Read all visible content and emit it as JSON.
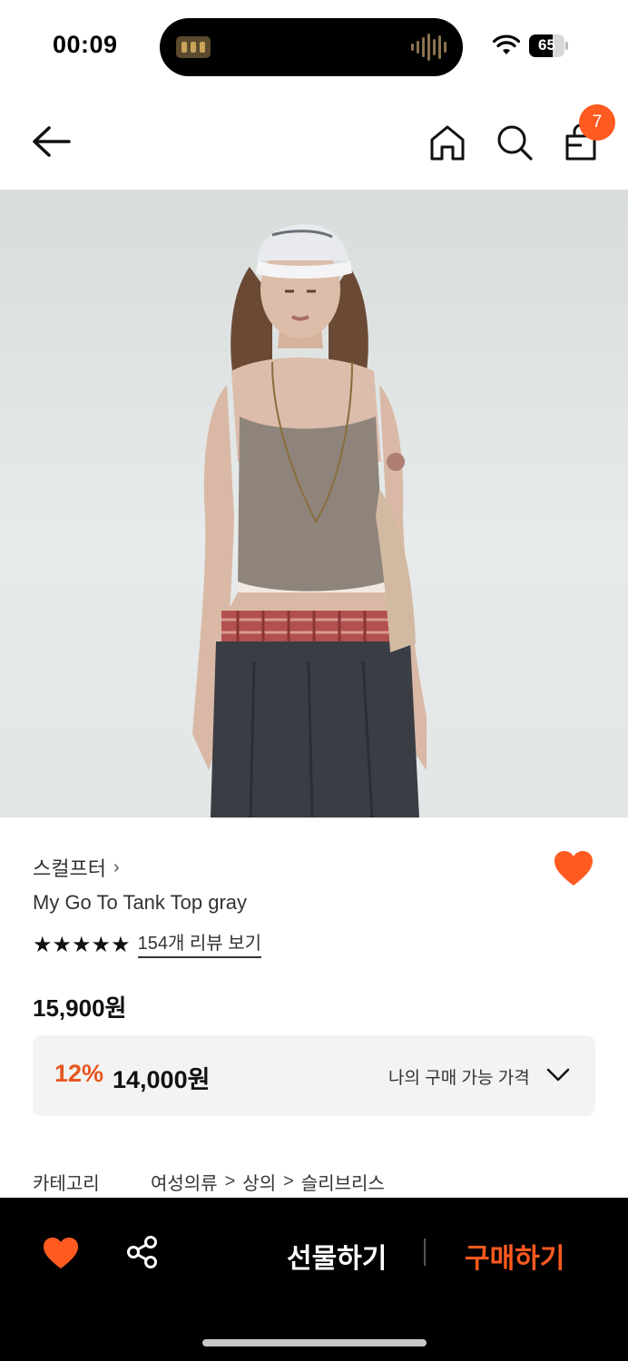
{
  "status_bar": {
    "time": "00:09",
    "battery": "65"
  },
  "nav": {
    "cart_count": "7"
  },
  "product": {
    "brand": "스컬프터",
    "brand_chevron": "›",
    "name": "My Go To Tank Top gray",
    "stars": "★★★★★",
    "rating_stars": 5,
    "review_link": "154개 리뷰 보기",
    "price": "15,900원",
    "wishlisted": true
  },
  "discount": {
    "rate": "12%",
    "price": "14,000원",
    "label": "나의 구매 가능 가격"
  },
  "category": {
    "key": "카테고리",
    "path": [
      "여성의류",
      "상의",
      "슬리브리스"
    ],
    "separator": ">"
  },
  "bottom_bar": {
    "gift_label": "선물하기",
    "buy_label": "구매하기"
  },
  "colors": {
    "accent": "#ff5a1f",
    "discount": "#e8561e",
    "bottom_bar": "#000000"
  },
  "icons": [
    "back-arrow-icon",
    "home-icon",
    "search-icon",
    "shopping-bag-icon",
    "heart-icon",
    "share-icon",
    "chevron-down-icon",
    "wifi-icon",
    "battery-icon"
  ]
}
